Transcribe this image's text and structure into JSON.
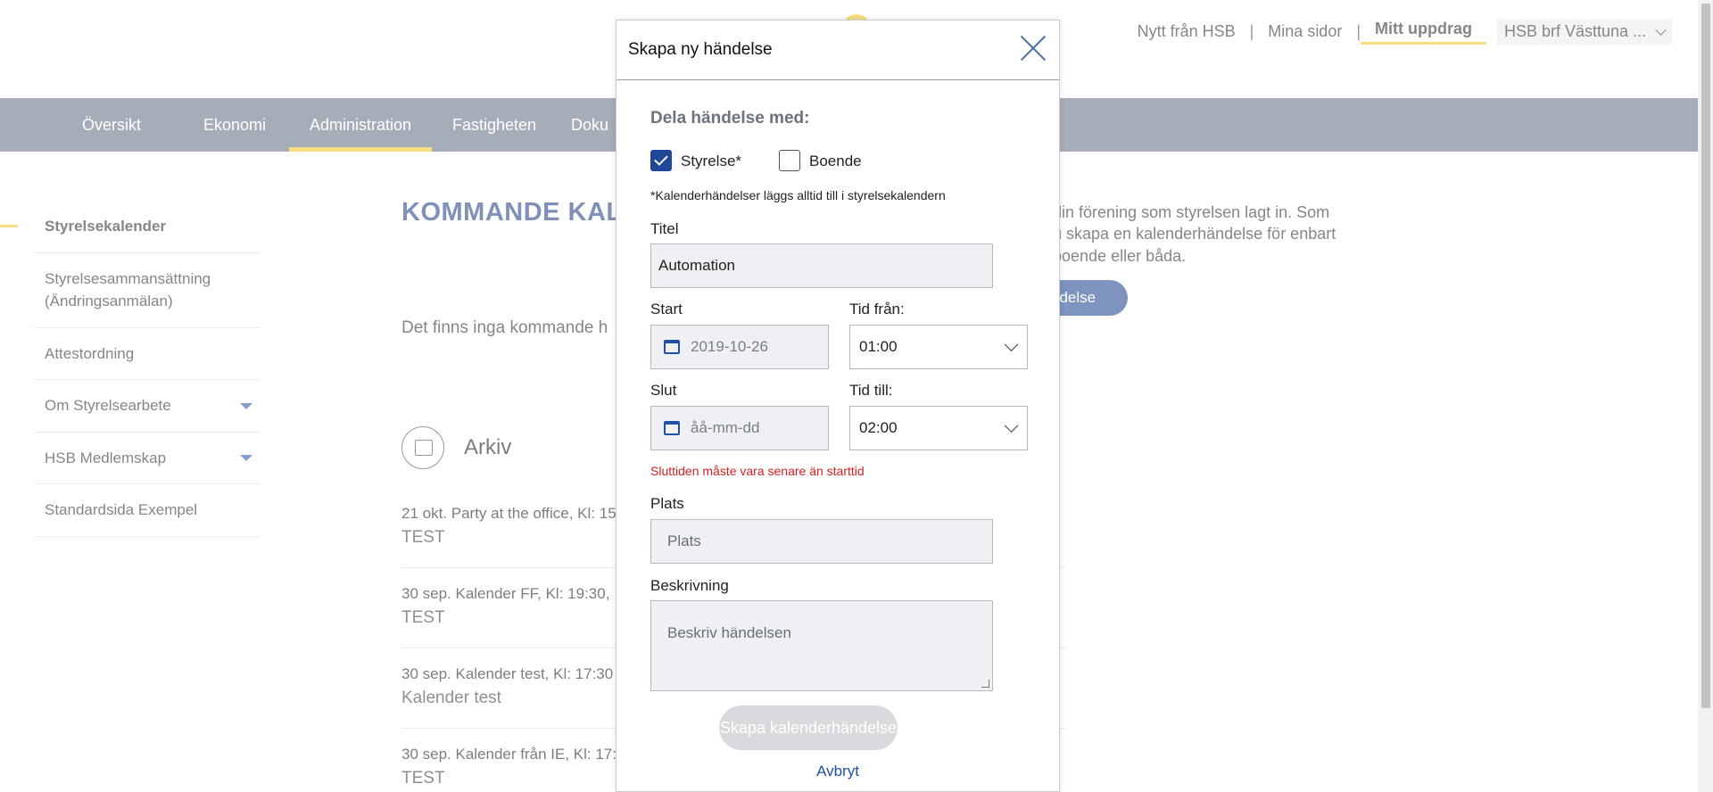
{
  "top_links": {
    "nytt": "Nytt från HSB",
    "mina": "Mina sidor",
    "mitt": "Mitt uppdrag",
    "org": "HSB brf Västtuna ..."
  },
  "nav": {
    "items": [
      "Översikt",
      "Ekonomi",
      "Administration",
      "Fastigheten",
      "Doku"
    ]
  },
  "sidebar": {
    "items": [
      {
        "label": "Styrelsekalender"
      },
      {
        "label": "Styrelsesammansättning (Ändringsanmälan)"
      },
      {
        "label": "Attestordning"
      },
      {
        "label": "Om Styrelsearbete"
      },
      {
        "label": "HSB Medlemskap"
      },
      {
        "label": "Standardsida Exempel"
      }
    ]
  },
  "main": {
    "title": "KOMMANDE KALE",
    "desc_line1": "din förening som styrelsen lagt in. Som",
    "desc_line2": "u skapa en kalenderhändelse för enbart",
    "desc_line3": "boende eller båda.",
    "create_btn": "ndelse",
    "no_upcoming": "Det finns inga kommande h",
    "archive_title": "Arkiv",
    "archive": [
      {
        "head": "21 okt. Party at the office, Kl: 15",
        "sub": "TEST"
      },
      {
        "head": "30 sep. Kalender FF, Kl: 19:30,",
        "sub": "TEST"
      },
      {
        "head": "30 sep. Kalender test, Kl: 17:30",
        "sub": "Kalender test"
      },
      {
        "head": "30 sep. Kalender från IE, Kl: 17:",
        "sub": "TEST"
      }
    ]
  },
  "modal": {
    "title": "Skapa ny händelse",
    "share_label": "Dela händelse med:",
    "styrelse": "Styrelse*",
    "boende": "Boende",
    "note": "*Kalenderhändelser läggs alltid till i styrelsekalendern",
    "title_label": "Titel",
    "title_value": "Automation",
    "start_label": "Start",
    "start_value": "2019-10-26",
    "time_from_label": "Tid från:",
    "time_from_value": "01:00",
    "end_label": "Slut",
    "end_placeholder": "åå-mm-dd",
    "time_to_label": "Tid till:",
    "time_to_value": "02:00",
    "error": "Sluttiden måste vara senare än starttid",
    "place_label": "Plats",
    "place_placeholder": "Plats",
    "desc_label": "Beskrivning",
    "desc_placeholder": "Beskriv händelsen",
    "submit": "Skapa kalenderhändelse",
    "cancel": "Avbryt"
  },
  "colors": {
    "accent": "#f2c21b",
    "nav_bg": "#5d6a7f",
    "brand_blue": "#163580",
    "error": "#d62020"
  }
}
